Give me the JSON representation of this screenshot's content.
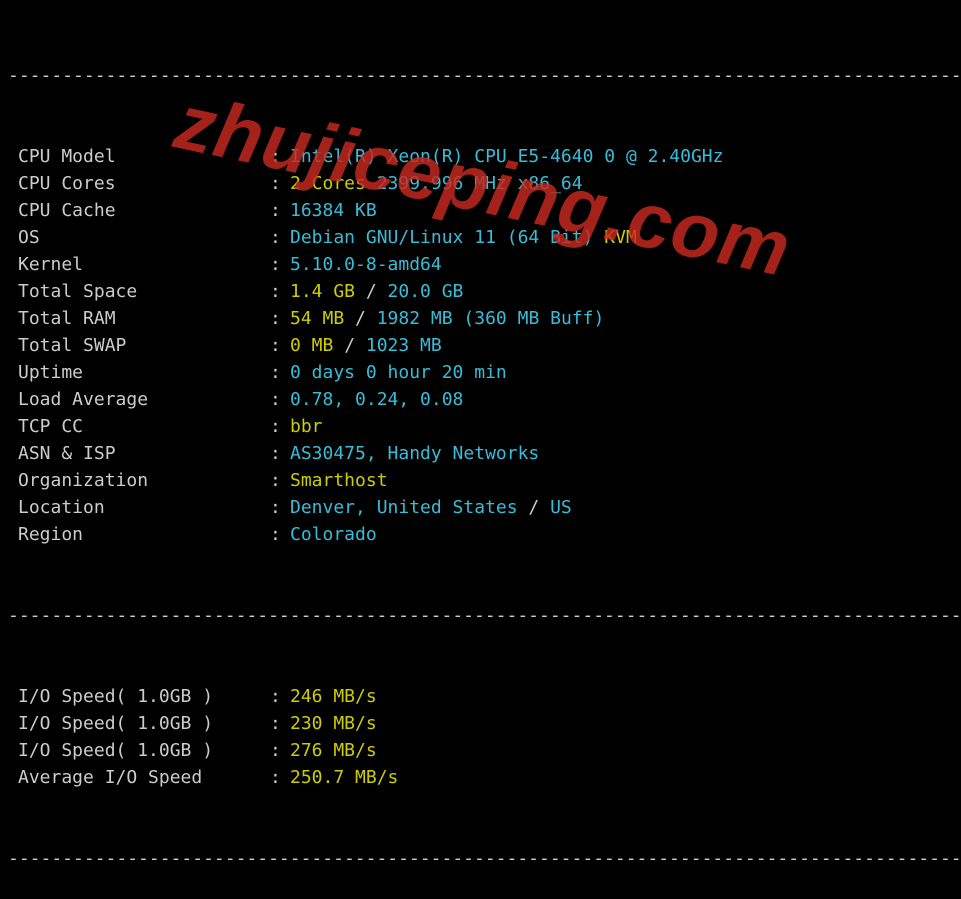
{
  "divider": "----------------------------------------------------------------------------------------------",
  "rows": [
    {
      "label": "CPU Model",
      "segments": [
        {
          "text": "Intel(R) Xeon(R) CPU E5-4640 0 @ 2.40GHz",
          "cls": "c-cyan"
        }
      ]
    },
    {
      "label": "CPU Cores",
      "segments": [
        {
          "text": "2 Cores",
          "cls": "c-yellow"
        },
        {
          "text": " 2399.996 MHz ",
          "cls": "c-cyan"
        },
        {
          "text": "x86_64",
          "cls": "c-cyan"
        }
      ]
    },
    {
      "label": "CPU Cache",
      "segments": [
        {
          "text": "16384 KB",
          "cls": "c-cyan"
        }
      ]
    },
    {
      "label": "OS",
      "segments": [
        {
          "text": "Debian GNU/Linux 11 (64 Bit) ",
          "cls": "c-cyan"
        },
        {
          "text": "KVM",
          "cls": "c-yellow"
        }
      ]
    },
    {
      "label": "Kernel",
      "segments": [
        {
          "text": "5.10.0-8-amd64",
          "cls": "c-cyan"
        }
      ]
    },
    {
      "label": "Total Space",
      "segments": [
        {
          "text": "1.4 GB ",
          "cls": "c-yellow"
        },
        {
          "text": "/",
          "cls": "c-white"
        },
        {
          "text": " 20.0 GB",
          "cls": "c-cyan"
        }
      ]
    },
    {
      "label": "Total RAM",
      "segments": [
        {
          "text": "54 MB ",
          "cls": "c-yellow"
        },
        {
          "text": "/",
          "cls": "c-white"
        },
        {
          "text": " 1982 MB ",
          "cls": "c-cyan"
        },
        {
          "text": "(360 MB Buff)",
          "cls": "c-cyan"
        }
      ]
    },
    {
      "label": "Total SWAP",
      "segments": [
        {
          "text": "0 MB ",
          "cls": "c-yellow"
        },
        {
          "text": "/",
          "cls": "c-white"
        },
        {
          "text": " 1023 MB",
          "cls": "c-cyan"
        }
      ]
    },
    {
      "label": "Uptime",
      "segments": [
        {
          "text": "0 days 0 hour 20 min",
          "cls": "c-cyan"
        }
      ]
    },
    {
      "label": "Load Average",
      "segments": [
        {
          "text": "0.78, 0.24, 0.08",
          "cls": "c-cyan"
        }
      ]
    },
    {
      "label": "TCP CC",
      "segments": [
        {
          "text": "bbr",
          "cls": "c-yellow"
        }
      ]
    },
    {
      "label": "ASN & ISP",
      "segments": [
        {
          "text": "AS30475, Handy Networks",
          "cls": "c-cyan"
        }
      ]
    },
    {
      "label": "Organization",
      "segments": [
        {
          "text": "Smarthost",
          "cls": "c-yellow"
        }
      ]
    },
    {
      "label": "Location",
      "segments": [
        {
          "text": "Denver, United States",
          "cls": "c-cyan"
        },
        {
          "text": " / ",
          "cls": "c-white"
        },
        {
          "text": "US",
          "cls": "c-cyan"
        }
      ]
    },
    {
      "label": "Region",
      "segments": [
        {
          "text": "Colorado",
          "cls": "c-cyan"
        }
      ]
    }
  ],
  "io_rows": [
    {
      "label": "I/O Speed( 1.0GB )",
      "value": "246 MB/s"
    },
    {
      "label": "I/O Speed( 1.0GB )",
      "value": "230 MB/s"
    },
    {
      "label": "I/O Speed( 1.0GB )",
      "value": "276 MB/s"
    },
    {
      "label": "Average I/O Speed",
      "value": "250.7 MB/s"
    }
  ],
  "watermark": "zhujiceping.com"
}
